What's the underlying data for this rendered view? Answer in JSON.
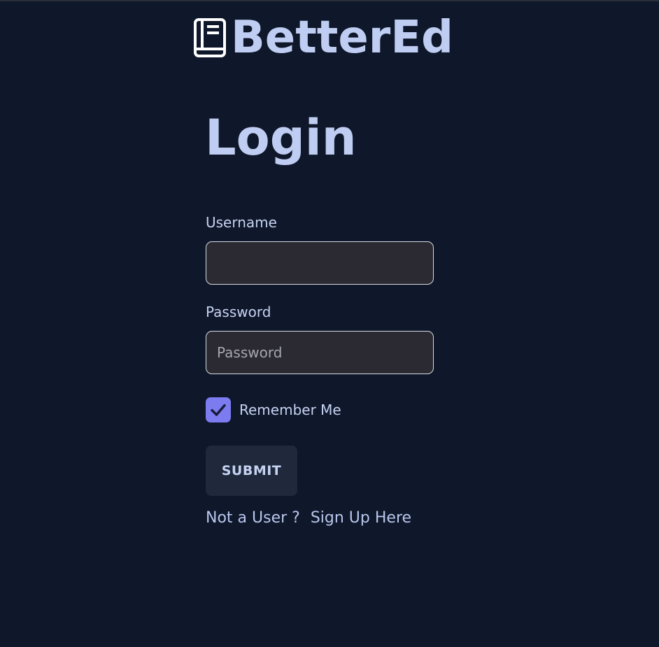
{
  "brand": {
    "name": "BetterEd",
    "icon": "book-icon"
  },
  "login": {
    "title": "Login",
    "username_label": "Username",
    "username_value": "",
    "username_placeholder": "",
    "password_label": "Password",
    "password_value": "",
    "password_placeholder": "Password",
    "remember_label": "Remember Me",
    "remember_checked": true,
    "submit_label": "SUBMIT",
    "signup_prompt": "Not a User ?",
    "signup_link": "Sign Up Here"
  },
  "colors": {
    "background": "#0f172a",
    "brand_text": "#bfcdf3",
    "input_bg": "#2b2a33",
    "checkbox_accent": "#7c7cf0",
    "button_bg": "#1f293b"
  }
}
